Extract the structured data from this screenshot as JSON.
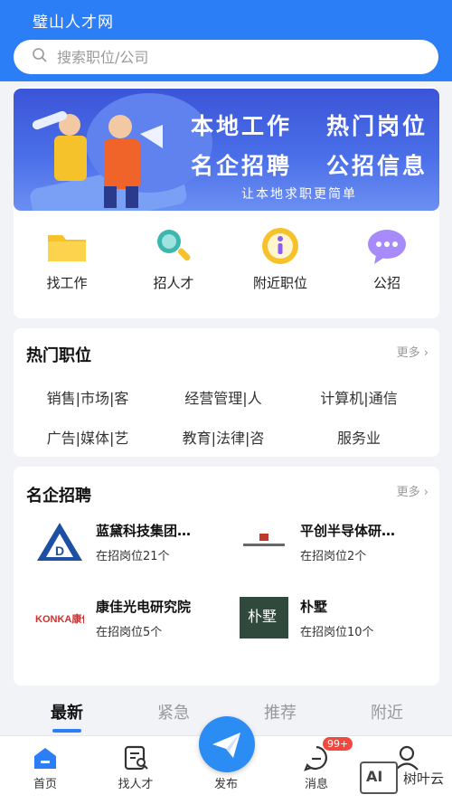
{
  "app": {
    "title": "璧山人才网"
  },
  "search": {
    "placeholder": "搜索职位/公司"
  },
  "banner": {
    "slogans": [
      "本地工作",
      "热门岗位",
      "名企招聘",
      "公招信息"
    ],
    "subtitle": "让本地求职更简单"
  },
  "quick_links": [
    {
      "label": "找工作",
      "icon": "folder-icon"
    },
    {
      "label": "招人才",
      "icon": "magnifier-icon"
    },
    {
      "label": "附近职位",
      "icon": "info-icon"
    },
    {
      "label": "公招",
      "icon": "chat-bubble-icon"
    }
  ],
  "hot_jobs": {
    "title": "热门职位",
    "more": "更多",
    "tags": [
      "销售|市场|客",
      "经营管理|人",
      "计算机|通信",
      "广告|媒体|艺",
      "教育|法律|咨",
      "服务业"
    ]
  },
  "enterprises": {
    "title": "名企招聘",
    "more": "更多",
    "items": [
      {
        "name": "蓝黛科技集团…",
        "count": "在招岗位21个",
        "logo": "landai-logo"
      },
      {
        "name": "平创半导体研…",
        "count": "在招岗位2个",
        "logo": "pingchuang-logo"
      },
      {
        "name": "康佳光电研究院",
        "count": "在招岗位5个",
        "logo": "konka-logo",
        "logo_text": "KONKA康佳"
      },
      {
        "name": "朴墅",
        "count": "在招岗位10个",
        "logo": "pushu-logo",
        "logo_text": "朴墅"
      }
    ]
  },
  "tabs": [
    "最新",
    "紧急",
    "推荐",
    "附近"
  ],
  "bottom_nav": {
    "items": [
      {
        "label": "首页",
        "icon": "home-icon"
      },
      {
        "label": "找人才",
        "icon": "resume-search-icon"
      },
      {
        "label": "发布",
        "icon": "paper-plane-icon"
      },
      {
        "label": "消息",
        "icon": "message-icon"
      }
    ],
    "badge": "99+"
  },
  "watermark": "树叶云",
  "colors": {
    "primary": "#2b7ef6",
    "badge": "#f04a3e"
  }
}
